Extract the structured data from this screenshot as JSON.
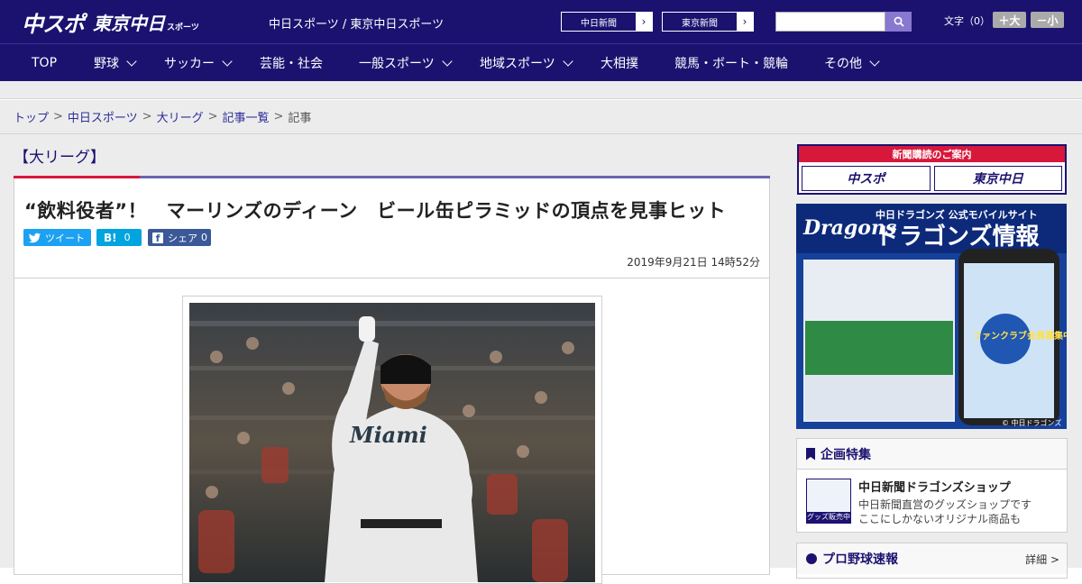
{
  "header": {
    "logo_main": "中スポ",
    "logo_tokyo": "東京中日",
    "logo_small": "スポーツ",
    "site_title": "中日スポーツ / 東京中日スポーツ",
    "paper_links": [
      "中日新聞",
      "東京新聞"
    ],
    "fontsize_label": "文字（0）",
    "fontsize_up": "＋大",
    "fontsize_down": "－小"
  },
  "nav": [
    "TOP",
    "野球",
    "サッカー",
    "芸能・社会",
    "一般スポーツ",
    "地域スポーツ",
    "大相撲",
    "競馬・ボート・競輪",
    "その他"
  ],
  "breadcrumb": {
    "links": [
      "トップ",
      "中日スポーツ",
      "大リーグ",
      "記事一覧"
    ],
    "current": "記事"
  },
  "article": {
    "section": "【大リーグ】",
    "headline": "“飲料役者”！　マーリンズのディーン　ビール缶ピラミッドの頂点を見事ヒット",
    "share": {
      "tweet": "ツイート",
      "hatena": "B!",
      "hatena_count": "0",
      "facebook": "シェア",
      "facebook_count": "0"
    },
    "date": "2019年9月21日 14時52分",
    "photo_jersey_text": "Miami"
  },
  "sidebar": {
    "subscribe_head": "新聞購読のご案内",
    "subscribe_logos": [
      "中スポ",
      "東京中日"
    ],
    "ad": {
      "top_line": "中日ドラゴンズ 公式モバイルサイト",
      "brand": "Dragons",
      "title": "ドラゴンズ情報",
      "badge": "ファンクラブ会員募集中",
      "copyright": "© 中日ドラゴンズ"
    },
    "feature_head": "企画特集",
    "feature_item_title": "中日新聞ドラゴンズショップ",
    "feature_item_desc1": "中日新聞直営のグッズショップです",
    "feature_item_desc2": "ここにしかないオリジナル商品も",
    "feature_thumb": "グッズ販売中",
    "baseball_head": "プロ野球速報",
    "baseball_more": "詳細 >"
  },
  "colors": {
    "brand": "#1b1270",
    "accent_red": "#d7183a",
    "twitter": "#1da1f2",
    "hatena": "#00a4de",
    "facebook": "#3b5998"
  }
}
